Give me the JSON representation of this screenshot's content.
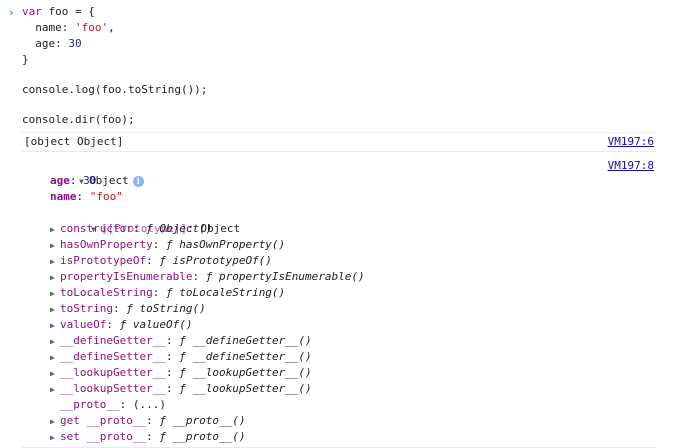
{
  "input": {
    "prompt": "›",
    "lines": [
      "var foo = {",
      "  name: 'foo',",
      "  age: 30",
      "}",
      "console.log(foo.toString());",
      "console.dir(foo);"
    ]
  },
  "log": {
    "text": "[object Object]",
    "source": "VM197:6"
  },
  "dir": {
    "source": "VM197:8",
    "root_label": "Object",
    "props": [
      {
        "key": "age",
        "value": "30"
      },
      {
        "key": "name",
        "value": "\"foo\""
      }
    ],
    "prototype": {
      "key": "[[Prototype]]",
      "value": "Object",
      "members": [
        {
          "key": "constructor",
          "fn": "Object()",
          "expandable": true
        },
        {
          "key": "hasOwnProperty",
          "fn": "hasOwnProperty()",
          "expandable": true
        },
        {
          "key": "isPrototypeOf",
          "fn": "isPrototypeOf()",
          "expandable": true
        },
        {
          "key": "propertyIsEnumerable",
          "fn": "propertyIsEnumerable()",
          "expandable": true
        },
        {
          "key": "toLocaleString",
          "fn": "toLocaleString()",
          "expandable": true
        },
        {
          "key": "toString",
          "fn": "toString()",
          "expandable": true
        },
        {
          "key": "valueOf",
          "fn": "valueOf()",
          "expandable": true
        },
        {
          "key": "__defineGetter__",
          "fn": "__defineGetter__()",
          "expandable": true
        },
        {
          "key": "__defineSetter__",
          "fn": "__defineSetter__()",
          "expandable": true
        },
        {
          "key": "__lookupGetter__",
          "fn": "__lookupGetter__()",
          "expandable": true
        },
        {
          "key": "__lookupSetter__",
          "fn": "__lookupSetter__()",
          "expandable": true
        },
        {
          "key": "__proto__",
          "fn": "(...)",
          "expandable": false,
          "plain": true
        },
        {
          "key": "get __proto__",
          "fn": "__proto__()",
          "expandable": true
        },
        {
          "key": "set __proto__",
          "fn": "__proto__()",
          "expandable": true
        }
      ]
    }
  },
  "symbols": {
    "collapsed": "▶",
    "expanded": "▼",
    "function": "ƒ",
    "info": "i"
  },
  "colors": {
    "property": "#881280",
    "string": "#c41a16",
    "number": "#1a1aa6",
    "link": "#1a0dab"
  }
}
